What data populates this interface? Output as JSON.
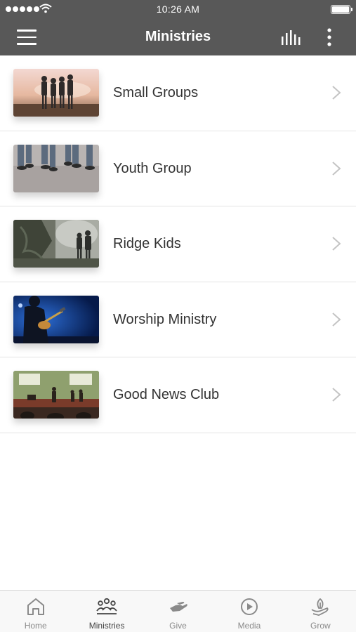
{
  "status_bar": {
    "time": "10:26 AM"
  },
  "nav": {
    "title": "Ministries"
  },
  "ministries": [
    {
      "label": "Small Groups"
    },
    {
      "label": "Youth Group"
    },
    {
      "label": "Ridge Kids"
    },
    {
      "label": "Worship Ministry"
    },
    {
      "label": "Good News Club"
    }
  ],
  "tabs": [
    {
      "label": "Home",
      "icon": "home-icon"
    },
    {
      "label": "Ministries",
      "icon": "people-icon",
      "active": true
    },
    {
      "label": "Give",
      "icon": "give-hand-icon"
    },
    {
      "label": "Media",
      "icon": "play-circle-icon"
    },
    {
      "label": "Grow",
      "icon": "leaf-hand-icon"
    }
  ],
  "colors": {
    "header_bg": "#585858",
    "tab_inactive": "#8a8a8a",
    "tab_active": "#444444"
  }
}
